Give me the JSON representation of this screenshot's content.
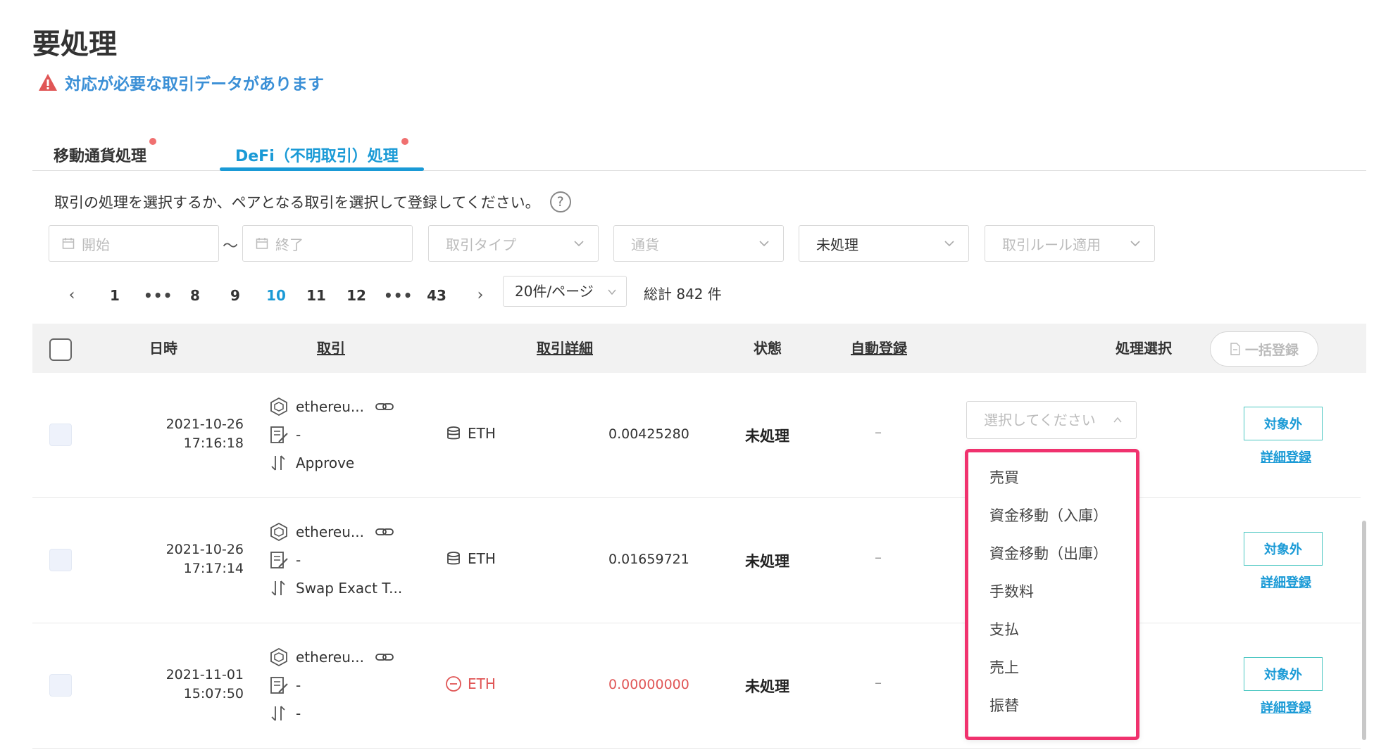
{
  "page": {
    "title": "要処理",
    "alert": "対応が必要な取引データがあります"
  },
  "tabs": [
    {
      "label": "移動通貨処理",
      "active": false,
      "has_notification": true
    },
    {
      "label": "DeFi（不明取引）処理",
      "active": true,
      "has_notification": true
    }
  ],
  "instruction": "取引の処理を選択するか、ペアとなる取引を選択して登録してください。",
  "help_icon": "?",
  "filters": {
    "start_placeholder": "開始",
    "range_separator": "〜",
    "end_placeholder": "終了",
    "tx_type_placeholder": "取引タイプ",
    "currency_placeholder": "通貨",
    "status_value": "未処理",
    "rule_placeholder": "取引ルール適用"
  },
  "pagination": {
    "prev": "‹",
    "pages": [
      "1",
      "•••",
      "8",
      "9",
      "10",
      "11",
      "12",
      "•••",
      "43"
    ],
    "current": "10",
    "next": "›",
    "page_size": "20件/ページ",
    "total": "総計 842 件"
  },
  "table": {
    "headers": {
      "datetime": "日時",
      "transaction": "取引",
      "details": "取引詳細",
      "status": "状態",
      "auto_register": "自動登録",
      "process_select": "処理選択",
      "bulk_register": "一括登録"
    },
    "rows": [
      {
        "date": "2021-10-26",
        "time": "17:16:18",
        "chain": "ethereu...",
        "memo": "-",
        "method": "Approve",
        "currency": "ETH",
        "amount": "0.00425280",
        "status": "未処理",
        "auto": "–",
        "exclude": "対象外",
        "detail": "詳細登録",
        "negative": false
      },
      {
        "date": "2021-10-26",
        "time": "17:17:14",
        "chain": "ethereu...",
        "memo": "-",
        "method": "Swap Exact T...",
        "currency": "ETH",
        "amount": "0.01659721",
        "status": "未処理",
        "auto": "–",
        "exclude": "対象外",
        "detail": "詳細登録",
        "negative": false
      },
      {
        "date": "2021-11-01",
        "time": "15:07:50",
        "chain": "ethereu...",
        "memo": "-",
        "method": "-",
        "currency": "ETH",
        "amount": "0.00000000",
        "status": "未処理",
        "auto": "–",
        "exclude": "対象外",
        "detail": "詳細登録",
        "negative": true
      }
    ]
  },
  "process_select": {
    "placeholder": "選択してください",
    "options": [
      "売買",
      "資金移動（入庫）",
      "資金移動（出庫）",
      "手数料",
      "支払",
      "売上",
      "振替"
    ],
    "highlight_color": "#f0326e"
  },
  "colors": {
    "accent": "#1a9ad6",
    "alert": "#3a8fd6",
    "warning_icon": "#e05656",
    "negative": "#e05656",
    "exclude_border": "#4cc7c2"
  }
}
